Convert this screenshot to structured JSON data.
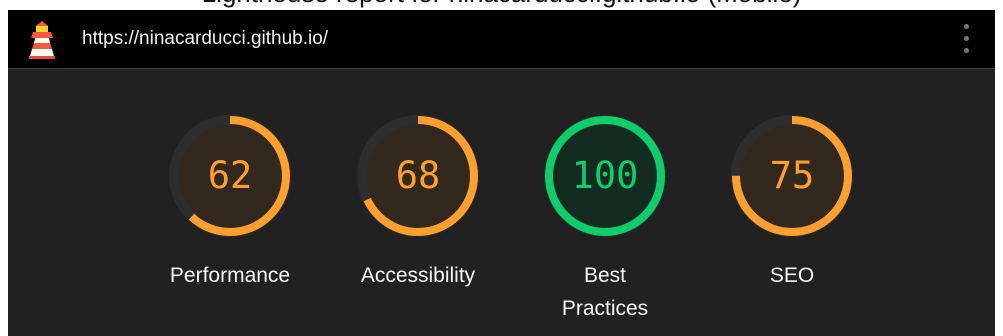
{
  "page": {
    "heading": "Lighthouse report for ninacarducci.github.io (Mobile)"
  },
  "topbar": {
    "url": "https://ninacarducci.github.io/",
    "logo_icon": "lighthouse-icon",
    "menu_icon": "kebab-menu-icon"
  },
  "colors": {
    "average": "#ff9f2f",
    "average_fill": "#33281d",
    "pass": "#0cce6b",
    "pass_fill": "#142c20",
    "track": "#2d2d2d",
    "panel_background": "#212121",
    "topbar_background": "#000000"
  },
  "scores": [
    {
      "label": "Performance",
      "score": "62",
      "rating": "average"
    },
    {
      "label": "Accessibility",
      "score": "68",
      "rating": "average"
    },
    {
      "label": "Best Practices",
      "score": "100",
      "rating": "pass"
    },
    {
      "label": "SEO",
      "score": "75",
      "rating": "average"
    }
  ]
}
